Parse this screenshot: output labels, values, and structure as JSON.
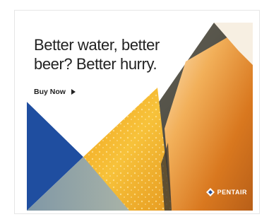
{
  "ad": {
    "headline_line1": "Better water, better",
    "headline_line2": "beer? Better hurry.",
    "cta_label": "Buy Now",
    "brand": "PENTAIR",
    "colors": {
      "blue": "#1f4ea0",
      "beer_light": "#f5b528",
      "beer_dark": "#c9741a",
      "text": "#222222"
    },
    "icons": [
      "arrow-right-icon",
      "pentair-logo-icon"
    ]
  }
}
